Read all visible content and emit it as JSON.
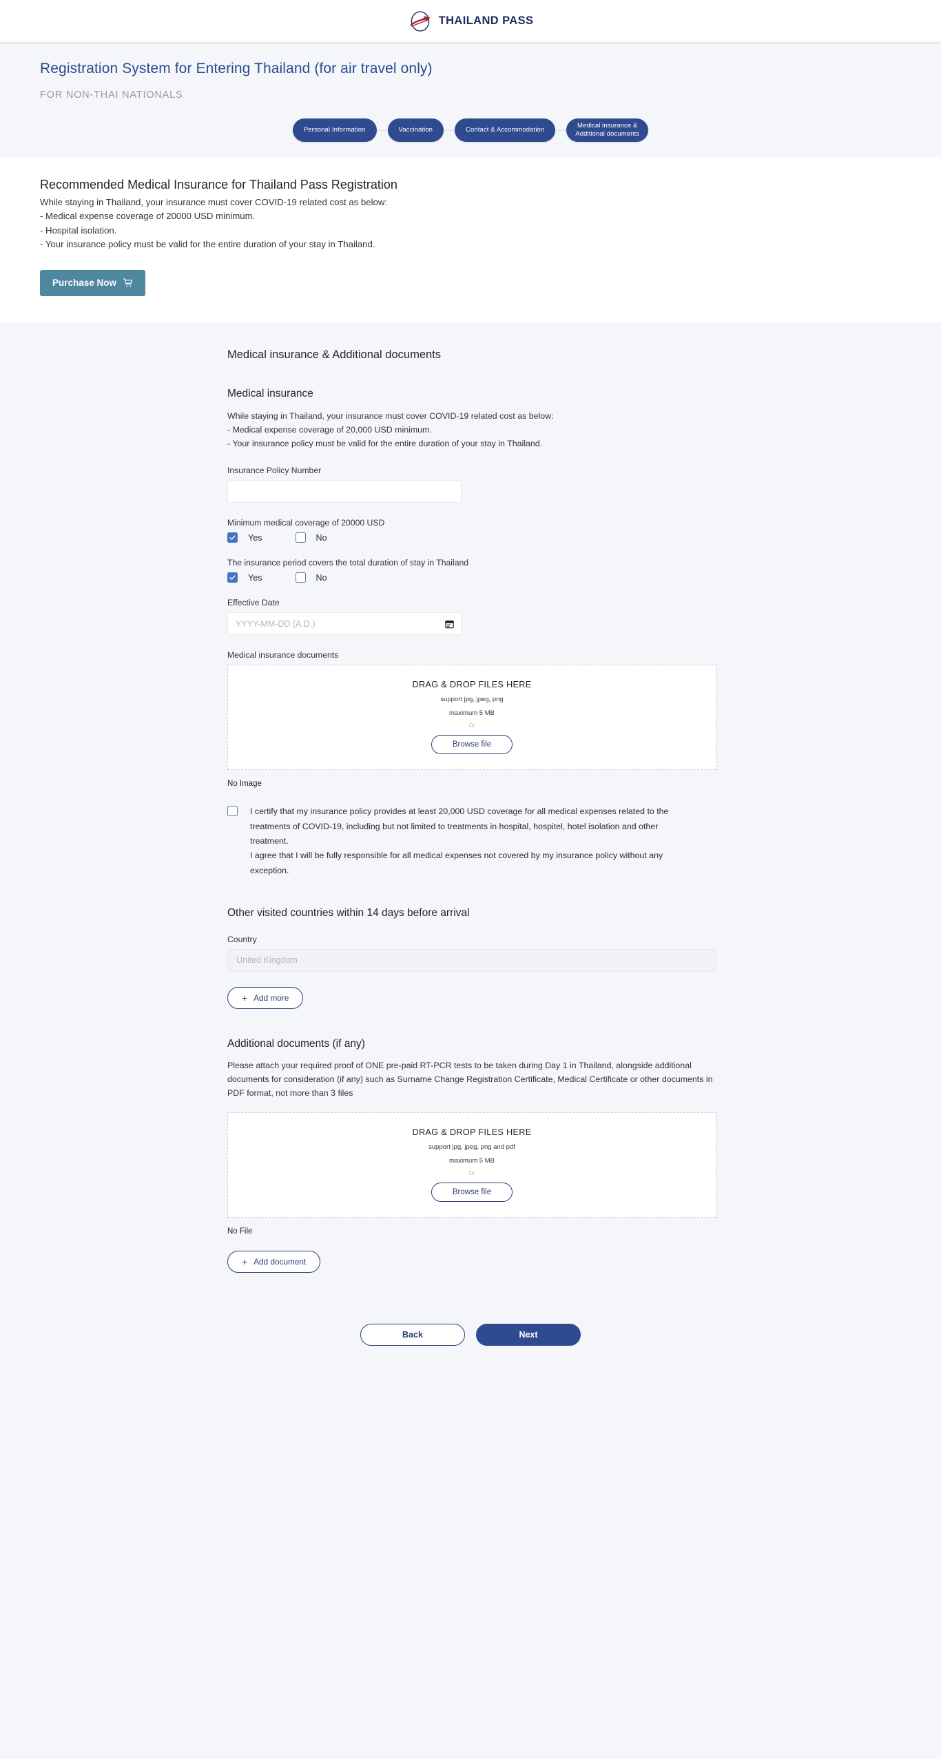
{
  "header": {
    "logo_text": "THAILAND PASS",
    "logo_icon": "thailand-pass-logo"
  },
  "title_band": {
    "title": "Registration System for Entering Thailand (for air travel only)",
    "subtitle": "FOR NON-THAI NATIONALS"
  },
  "stepper": {
    "steps": [
      {
        "label": "Personal Information"
      },
      {
        "label": "Vaccination"
      },
      {
        "label": "Contact & Accommodation"
      },
      {
        "label": "Medical insurance &\nAdditional documents"
      }
    ]
  },
  "recommended": {
    "title": "Recommended Medical Insurance for Thailand Pass Registration",
    "line1": "While staying in Thailand, your insurance must cover COVID-19 related cost as below:",
    "line2": "- Medical expense coverage of 20000 USD minimum.",
    "line3": "- Hospital isolation.",
    "line4": "- Your insurance policy must be valid for the entire duration of your stay in Thailand.",
    "purchase_label": "Purchase Now",
    "cart_icon": "shopping-cart-icon",
    "button_color": "#4d87a0"
  },
  "form": {
    "section_title": "Medical insurance & Additional documents",
    "medical": {
      "heading": "Medical insurance",
      "line1": "While staying in Thailand, your insurance must cover COVID-19 related cost as below:",
      "line2": "- Medical expense coverage of 20,000 USD minimum.",
      "line3": "- Your insurance policy must be valid for the entire duration of your stay in Thailand.",
      "policy_label": "Insurance Policy Number",
      "policy_value": "",
      "policy_placeholder": "",
      "coverage_question": "Minimum medical coverage of 20000 USD",
      "coverage_yes": "Yes",
      "coverage_no": "No",
      "coverage_selected": "Yes",
      "period_question": "The insurance period covers the total duration of stay in Thailand",
      "period_yes": "Yes",
      "period_no": "No",
      "period_selected": "Yes",
      "effective_date_label": "Effective Date",
      "effective_date_value": "",
      "effective_date_placeholder": "YYYY-MM-DD (A.D.)",
      "calendar_icon": "calendar-icon",
      "documents_label": "Medical insurance documents",
      "dropzone": {
        "title": "DRAG & DROP FILES HERE",
        "support": "support jpg, jpeg, png",
        "maximum": "maximum 5 MB",
        "or": "Or",
        "browse_label": "Browse file"
      },
      "no_image": "No Image",
      "certify_checked": false,
      "certify_p1": "I certify that my insurance policy provides at least 20,000 USD coverage for all medical expenses related to the treatments of COVID-19, including but not limited to treatments in hospital, hospitel, hotel isolation and other treatment.",
      "certify_p2": "I agree that I will be fully responsible for all medical expenses not covered by my insurance policy without any exception."
    },
    "countries": {
      "heading": "Other visited countries within 14 days before arrival",
      "country_label": "Country",
      "country_value": "",
      "country_placeholder": "United Kingdom",
      "add_more_label": "Add more",
      "plus_icon": "plus-icon"
    },
    "additional": {
      "heading": "Additional documents (if any)",
      "description": "Please attach your required proof of ONE pre-paid RT-PCR tests to be taken during Day 1 in Thailand, alongside additional documents for consideration (if any) such as Surname Change Registration Certificate, Medical Certificate or other documents in PDF format, not more than 3 files",
      "dropzone": {
        "title": "DRAG & DROP FILES HERE",
        "support": "support jpg, jpeg, png and pdf",
        "maximum": "maximum 5 MB",
        "or": "Or",
        "browse_label": "Browse file"
      },
      "no_file": "No File",
      "add_document_label": "Add document",
      "plus_icon": "plus-icon"
    }
  },
  "footer": {
    "back_label": "Back",
    "next_label": "Next",
    "next_color": "#2f4b8f"
  }
}
